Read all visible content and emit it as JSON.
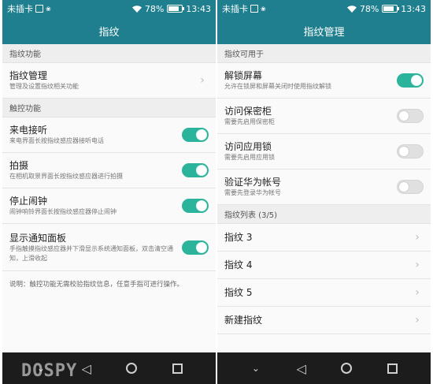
{
  "status_bar": {
    "carrier": "未插卡",
    "battery": "78%",
    "time": "13:43"
  },
  "left": {
    "title": "指纹",
    "section1": "指纹功能",
    "manage": {
      "title": "指纹管理",
      "sub": "管理及设置指纹相关功能"
    },
    "section2": "触控功能",
    "items": [
      {
        "title": "来电接听",
        "sub": "来电界面长按指纹感应器接听电话",
        "on": true
      },
      {
        "title": "拍摄",
        "sub": "在相机取景界面长按指纹感应器进行拍摄",
        "on": true
      },
      {
        "title": "停止闹钟",
        "sub": "闹钟响铃界面长按指纹感应器停止闹钟",
        "on": true
      },
      {
        "title": "显示通知面板",
        "sub": "手指触摸指纹感应器并下滑显示系统通知面板，双击清空通知，上滑收起",
        "on": true
      }
    ],
    "note": "说明：触控功能无需校验指纹信息，任意手指可进行操作。"
  },
  "right": {
    "title": "指纹管理",
    "section1": "指纹可用于",
    "items": [
      {
        "title": "解锁屏幕",
        "sub": "允许在锁屏和屏幕关闭时使用指纹解锁",
        "on": true
      },
      {
        "title": "访问保密柜",
        "sub": "需要先启用保密柜",
        "on": false
      },
      {
        "title": "访问应用锁",
        "sub": "需要先启用应用锁",
        "on": false
      },
      {
        "title": "验证华为帐号",
        "sub": "需要先登录华为帐号",
        "on": false
      }
    ],
    "section2": "指纹列表 (3/5)",
    "fingerprints": [
      "指纹 3",
      "指纹 4",
      "指纹 5",
      "新建指纹"
    ]
  },
  "watermark": "DOSPY",
  "colors": {
    "accent": "#1f7f8f",
    "toggle_on": "#2bb39c"
  }
}
